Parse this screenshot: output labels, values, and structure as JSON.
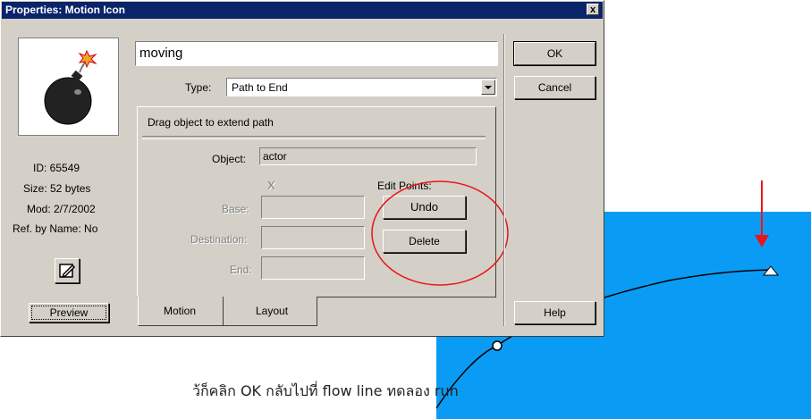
{
  "dialog": {
    "title": "Properties: Motion Icon",
    "close_label": "x"
  },
  "icon_panel": {
    "id_label": "ID: 65549",
    "size_label": "Size: 52 bytes",
    "mod_label": "Mod: 2/7/2002",
    "ref_label": "Ref. by Name: No",
    "preview_label": "Preview"
  },
  "name_field": {
    "value": "moving"
  },
  "type_select": {
    "label": "Type:",
    "value": "Path to End"
  },
  "path_group": {
    "instruction": "Drag object to extend path",
    "object_label": "Object:",
    "object_value": "actor",
    "x_marker": "X",
    "base_label": "Base:",
    "destination_label": "Destination:",
    "end_label": "End:",
    "edit_points_label": "Edit Points:",
    "undo_label": "Undo",
    "delete_label": "Delete"
  },
  "tabs": [
    {
      "label": "Motion"
    },
    {
      "label": "Layout"
    }
  ],
  "buttons": {
    "ok": "OK",
    "cancel": "Cancel",
    "help": "Help"
  },
  "caption": "ว้ก็คลิก OK กลับไปที่ flow line ทดลอง run",
  "colors": {
    "title_bar": "#0a246a",
    "dialog_bg": "#d4d0c8",
    "stage_bg": "#0a9cf5",
    "annotation_red": "#e8151b"
  }
}
